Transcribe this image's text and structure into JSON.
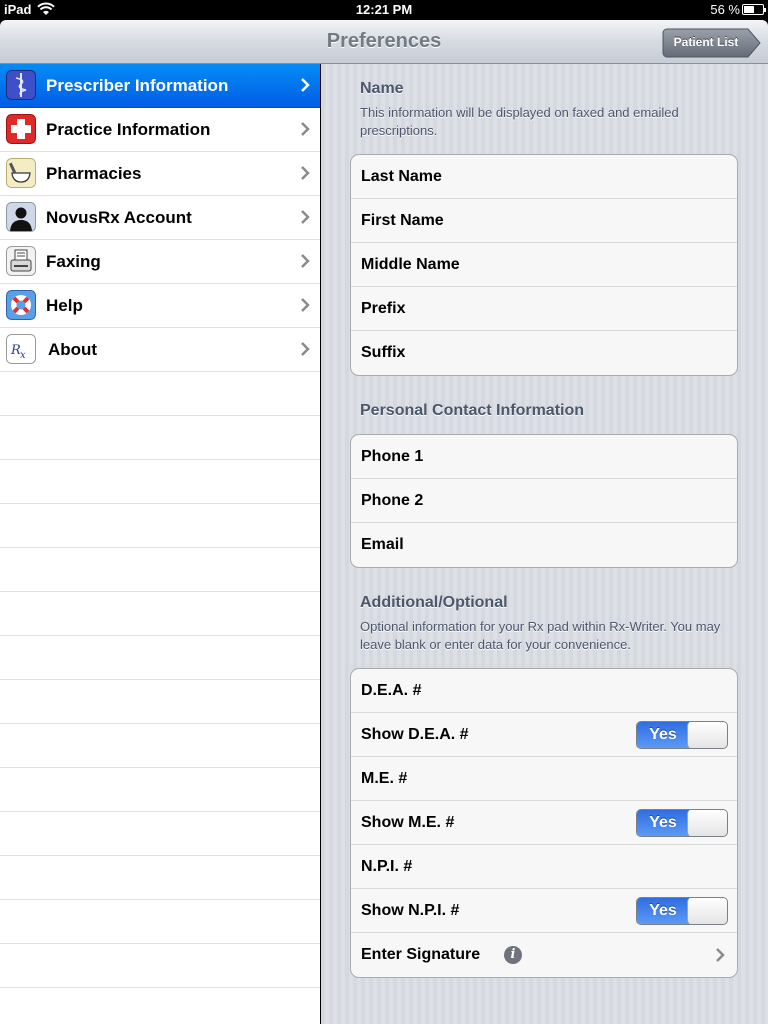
{
  "status": {
    "carrier": "iPad",
    "time": "12:21 PM",
    "battery": "56 %"
  },
  "nav": {
    "title": "Preferences",
    "back_label": "Patient List"
  },
  "sidebar": {
    "items": [
      {
        "label": "Prescriber Information",
        "icon": "caduceus-icon",
        "selected": true
      },
      {
        "label": "Practice Information",
        "icon": "red-cross-icon",
        "selected": false
      },
      {
        "label": "Pharmacies",
        "icon": "mortar-pestle-icon",
        "selected": false
      },
      {
        "label": "NovusRx Account",
        "icon": "user-silhouette-icon",
        "selected": false
      },
      {
        "label": "Faxing",
        "icon": "fax-machine-icon",
        "selected": false
      },
      {
        "label": "Help",
        "icon": "life-ring-icon",
        "selected": false
      },
      {
        "label": "About",
        "icon": "rx-logo-icon",
        "selected": false
      }
    ]
  },
  "detail": {
    "name": {
      "header": "Name",
      "description": "This information will be displayed on faxed and emailed prescriptions.",
      "fields": [
        "Last Name",
        "First Name",
        "Middle Name",
        "Prefix",
        "Suffix"
      ]
    },
    "contact": {
      "header": "Personal Contact Information",
      "fields": [
        "Phone 1",
        "Phone 2",
        "Email"
      ]
    },
    "additional": {
      "header": "Additional/Optional",
      "description": "Optional information for your Rx pad within Rx-Writer. You may leave blank or enter data for your convenience.",
      "dea": "D.E.A. #",
      "show_dea": "Show D.E.A. #",
      "me": "M.E. #",
      "show_me": "Show M.E. #",
      "npi": "N.P.I. #",
      "show_npi": "Show N.P.I. #",
      "signature": "Enter Signature",
      "toggle_on": "Yes"
    }
  },
  "colors": {
    "selected": "#0a72ee",
    "nav_title": "#717a85",
    "section_text": "#4c566c",
    "toggle_on": "#3a7ce8"
  }
}
